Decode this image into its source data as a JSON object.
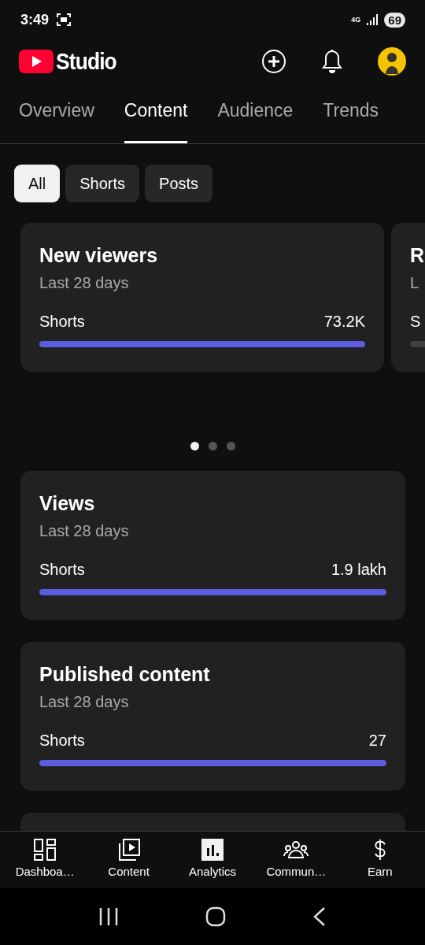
{
  "status_bar": {
    "time": "3:49",
    "network": "4G",
    "battery": "69"
  },
  "header": {
    "logo_text": "Studio"
  },
  "tabs": [
    {
      "label": "Overview",
      "selected": false
    },
    {
      "label": "Content",
      "selected": true
    },
    {
      "label": "Audience",
      "selected": false
    },
    {
      "label": "Trends",
      "selected": false
    }
  ],
  "filters": [
    {
      "label": "All",
      "selected": true
    },
    {
      "label": "Shorts",
      "selected": false
    },
    {
      "label": "Posts",
      "selected": false
    }
  ],
  "carousel": {
    "cards": [
      {
        "title": "New viewers",
        "period": "Last 28 days",
        "label": "Shorts",
        "value": "73.2K",
        "level": 1
      },
      {
        "title": "R",
        "period": "L",
        "label": "S",
        "level": 0
      }
    ],
    "pages": [
      {
        "selected": true
      },
      {
        "selected": false
      },
      {
        "selected": false
      }
    ]
  },
  "cards": [
    {
      "title": "Views",
      "period": "Last 28 days",
      "label": "Shorts",
      "value": "1.9 lakh",
      "level": 1
    },
    {
      "title": "Published content",
      "period": "Last 28 days",
      "label": "Shorts",
      "value": "27",
      "level": 1
    }
  ],
  "bottom_nav": [
    {
      "label": "Dashboa…",
      "selected": false
    },
    {
      "label": "Content",
      "selected": false
    },
    {
      "label": "Analytics",
      "selected": true
    },
    {
      "label": "Commun…",
      "selected": false
    },
    {
      "label": "Earn",
      "selected": false
    }
  ]
}
